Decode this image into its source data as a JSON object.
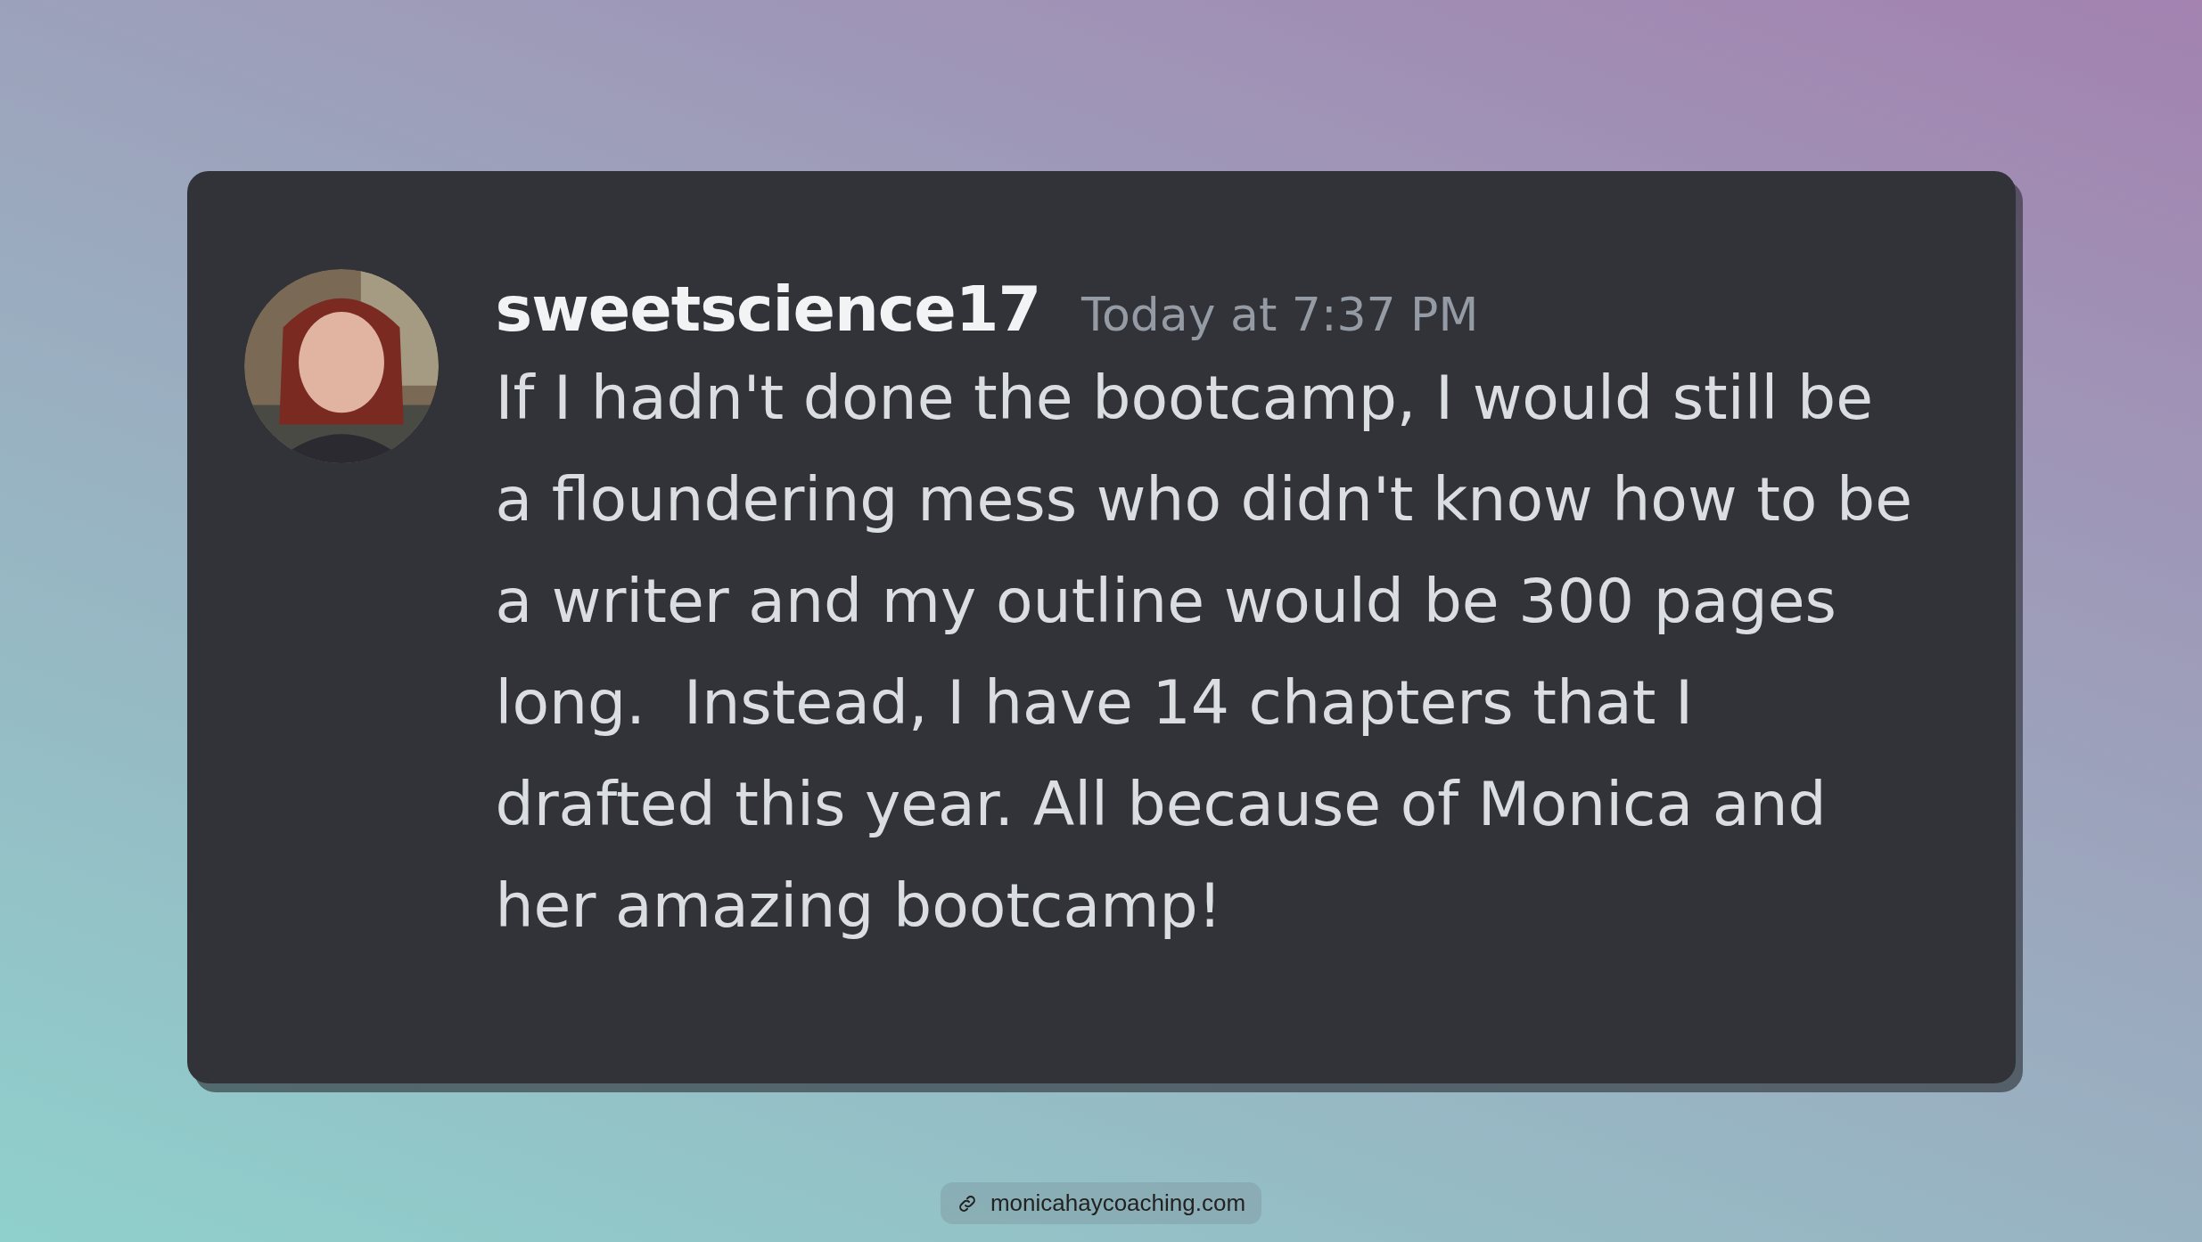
{
  "message": {
    "username": "sweetscience17",
    "timestamp": "Today at 7:37 PM",
    "text": "If I hadn't done the bootcamp, I would still be a floundering mess who didn't know how to be a writer and my outline would be 300 pages long.  Instead, I have 14 chapters that I drafted this year. All because of Monica and her amazing bootcamp!"
  },
  "source_link": {
    "label": "monicahaycoaching.com"
  }
}
